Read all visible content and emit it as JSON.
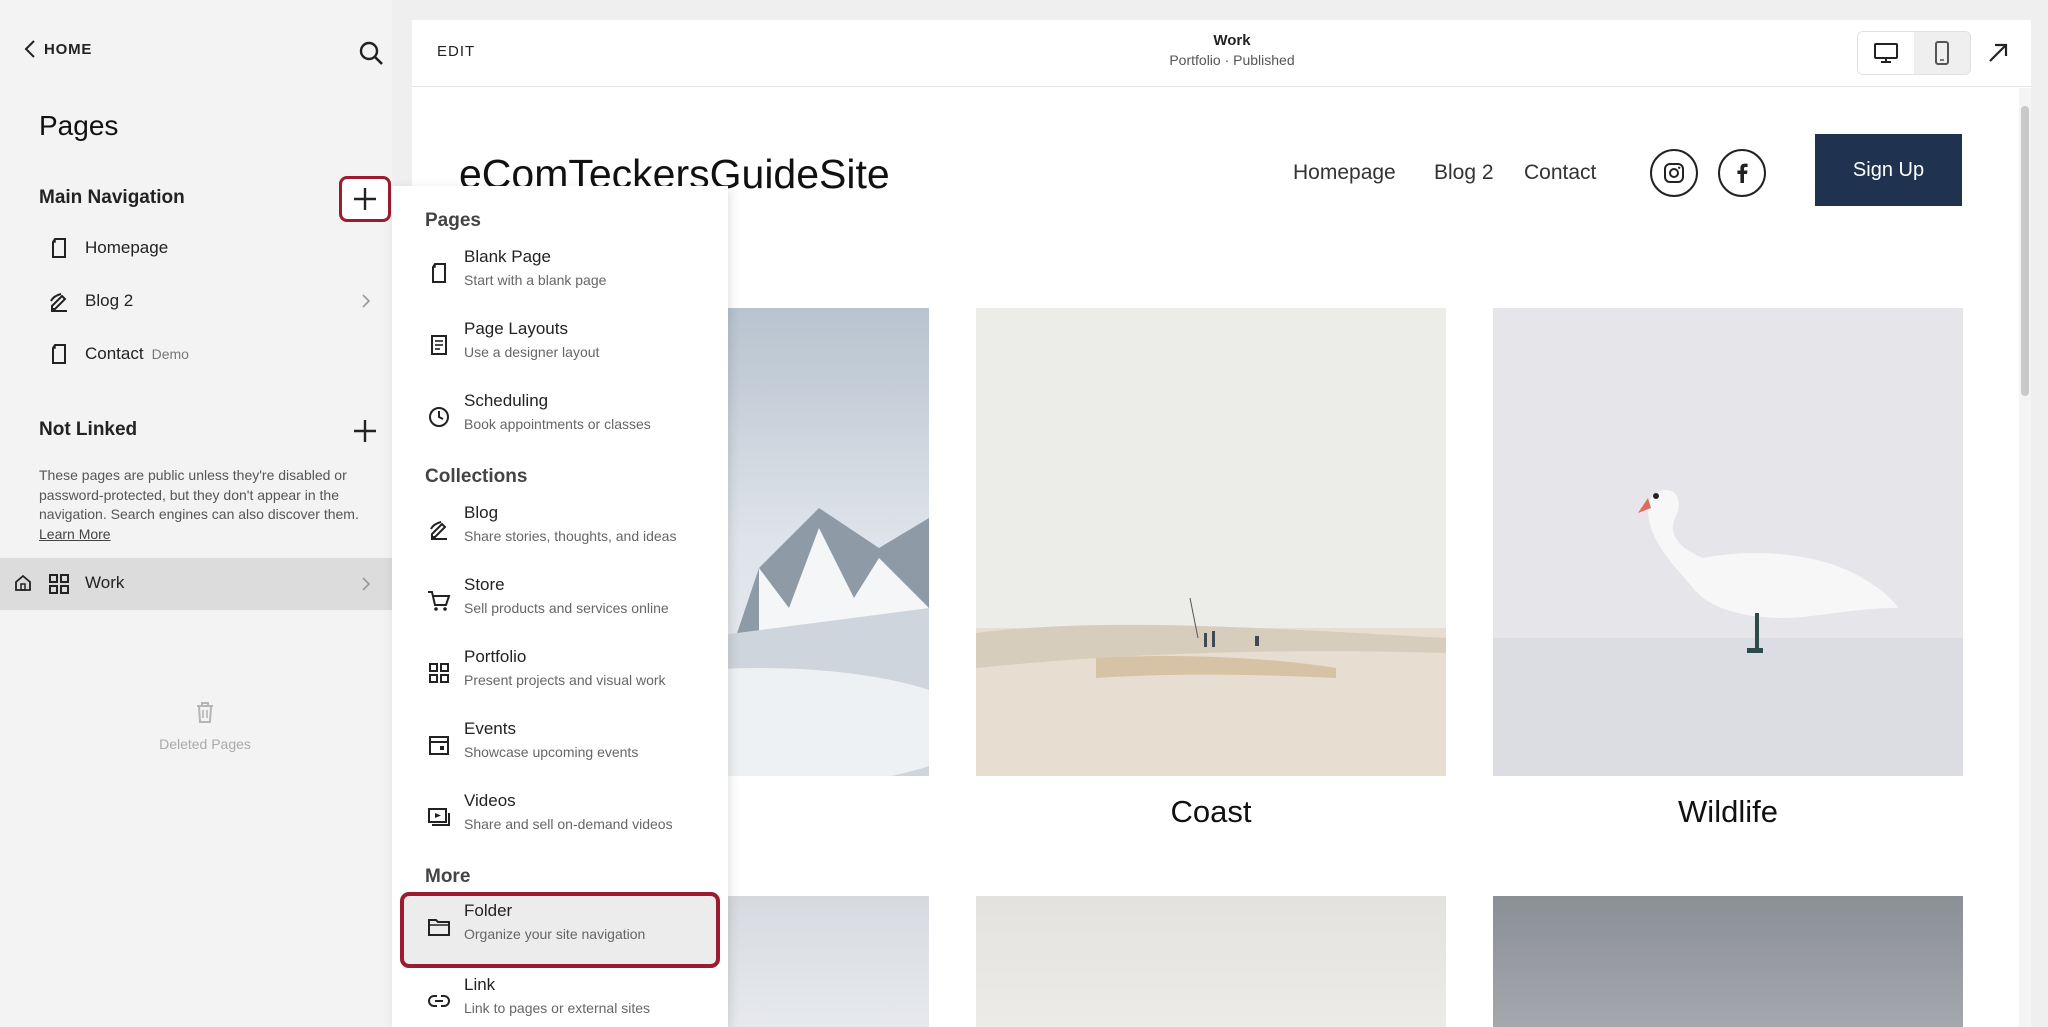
{
  "sidebar": {
    "home_label": "HOME",
    "title": "Pages",
    "main_nav": {
      "heading": "Main Navigation",
      "items": [
        {
          "label": "Homepage",
          "tag": "",
          "icon": "page-icon"
        },
        {
          "label": "Blog 2",
          "tag": "",
          "icon": "blog-icon"
        },
        {
          "label": "Contact",
          "tag": "Demo",
          "icon": "page-icon"
        }
      ]
    },
    "not_linked": {
      "heading": "Not Linked",
      "description": "These pages are public unless they're disabled or password-protected, but they don't appear in the navigation. Search engines can also discover them.",
      "learn_more": "Learn More",
      "work_label": "Work"
    },
    "deleted_label": "Deleted Pages"
  },
  "topbar": {
    "edit_label": "EDIT",
    "page_title": "Work",
    "page_subtitle": "Portfolio · Published"
  },
  "site": {
    "title": "eComTeckersGuideSite",
    "nav": [
      "Homepage",
      "Blog 2",
      "Contact"
    ],
    "signup_label": "Sign Up",
    "tiles": [
      {
        "caption": "s"
      },
      {
        "caption": "Coast"
      },
      {
        "caption": "Wildlife"
      }
    ]
  },
  "dropdown": {
    "sections": [
      {
        "heading": "Pages",
        "items": [
          {
            "title": "Blank Page",
            "sub": "Start with a blank page",
            "icon": "page-icon"
          },
          {
            "title": "Page Layouts",
            "sub": "Use a designer layout",
            "icon": "layout-icon"
          },
          {
            "title": "Scheduling",
            "sub": "Book appointments or classes",
            "icon": "clock-icon"
          }
        ]
      },
      {
        "heading": "Collections",
        "items": [
          {
            "title": "Blog",
            "sub": "Share stories, thoughts, and ideas",
            "icon": "blog-icon"
          },
          {
            "title": "Store",
            "sub": "Sell products and services online",
            "icon": "cart-icon"
          },
          {
            "title": "Portfolio",
            "sub": "Present projects and visual work",
            "icon": "grid-icon"
          },
          {
            "title": "Events",
            "sub": "Showcase upcoming events",
            "icon": "calendar-icon"
          },
          {
            "title": "Videos",
            "sub": "Share and sell on-demand videos",
            "icon": "video-icon"
          }
        ]
      },
      {
        "heading": "More",
        "items": [
          {
            "title": "Folder",
            "sub": "Organize your site navigation",
            "icon": "folder-icon",
            "selected": true
          },
          {
            "title": "Link",
            "sub": "Link to pages or external sites",
            "icon": "link-icon"
          }
        ]
      }
    ]
  },
  "colors": {
    "highlight": "#9b1c2e",
    "signup_bg": "#1f3350",
    "sidebar_bg": "#f3f3f3",
    "selected_row_bg": "#dcdcdc"
  }
}
